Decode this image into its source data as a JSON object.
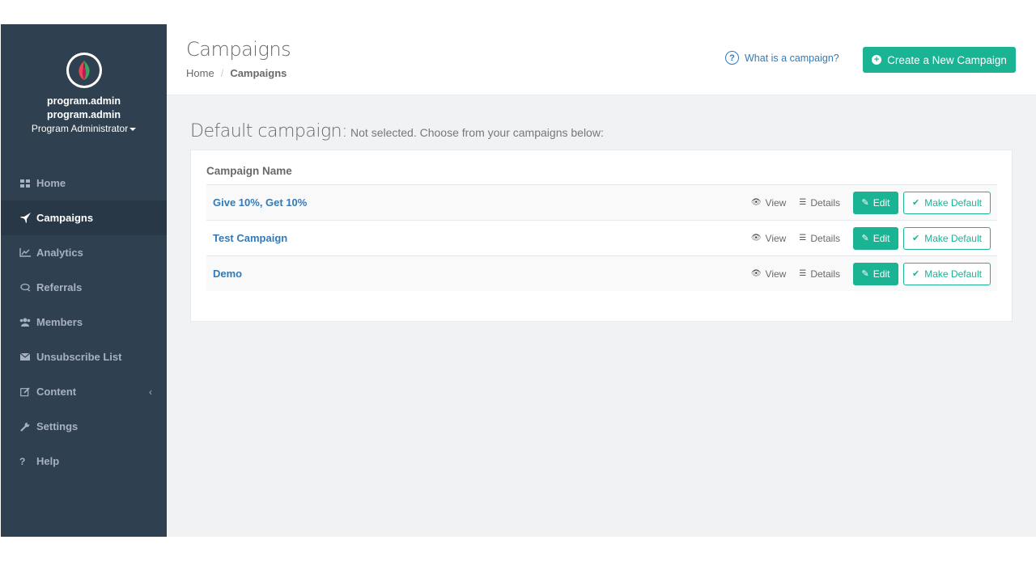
{
  "sidebar": {
    "user": {
      "name_line1": "program.admin",
      "name_line2": "program.admin",
      "role": "Program Administrator"
    },
    "items": [
      {
        "label": "Home",
        "icon": "th-large-icon"
      },
      {
        "label": "Campaigns",
        "icon": "rocket-icon",
        "active": true
      },
      {
        "label": "Analytics",
        "icon": "line-chart-icon"
      },
      {
        "label": "Referrals",
        "icon": "comments-icon"
      },
      {
        "label": "Members",
        "icon": "users-icon"
      },
      {
        "label": "Unsubscribe List",
        "icon": "envelope-icon"
      },
      {
        "label": "Content",
        "icon": "edit-icon",
        "chevron": "‹"
      },
      {
        "label": "Settings",
        "icon": "wrench-icon"
      },
      {
        "label": "Help",
        "icon": "question-icon"
      }
    ]
  },
  "header": {
    "title": "Campaigns",
    "breadcrumb": {
      "home": "Home",
      "separator": "/",
      "current": "Campaigns"
    },
    "help_link": "What is a campaign?",
    "create_button": "Create a New Campaign"
  },
  "main": {
    "default_title": "Default campaign:",
    "default_status": "Not selected. Choose from your campaigns below:",
    "table_header": "Campaign Name",
    "actions": {
      "view": "View",
      "details": "Details",
      "edit": "Edit",
      "make_default": "Make Default"
    },
    "campaigns": [
      {
        "name": "Give 10%, Get 10%"
      },
      {
        "name": "Test Campaign"
      },
      {
        "name": "Demo"
      }
    ]
  },
  "colors": {
    "sidebar_bg": "#2f4050",
    "sidebar_active": "#293846",
    "accent": "#1ab394",
    "link": "#337ab7"
  }
}
